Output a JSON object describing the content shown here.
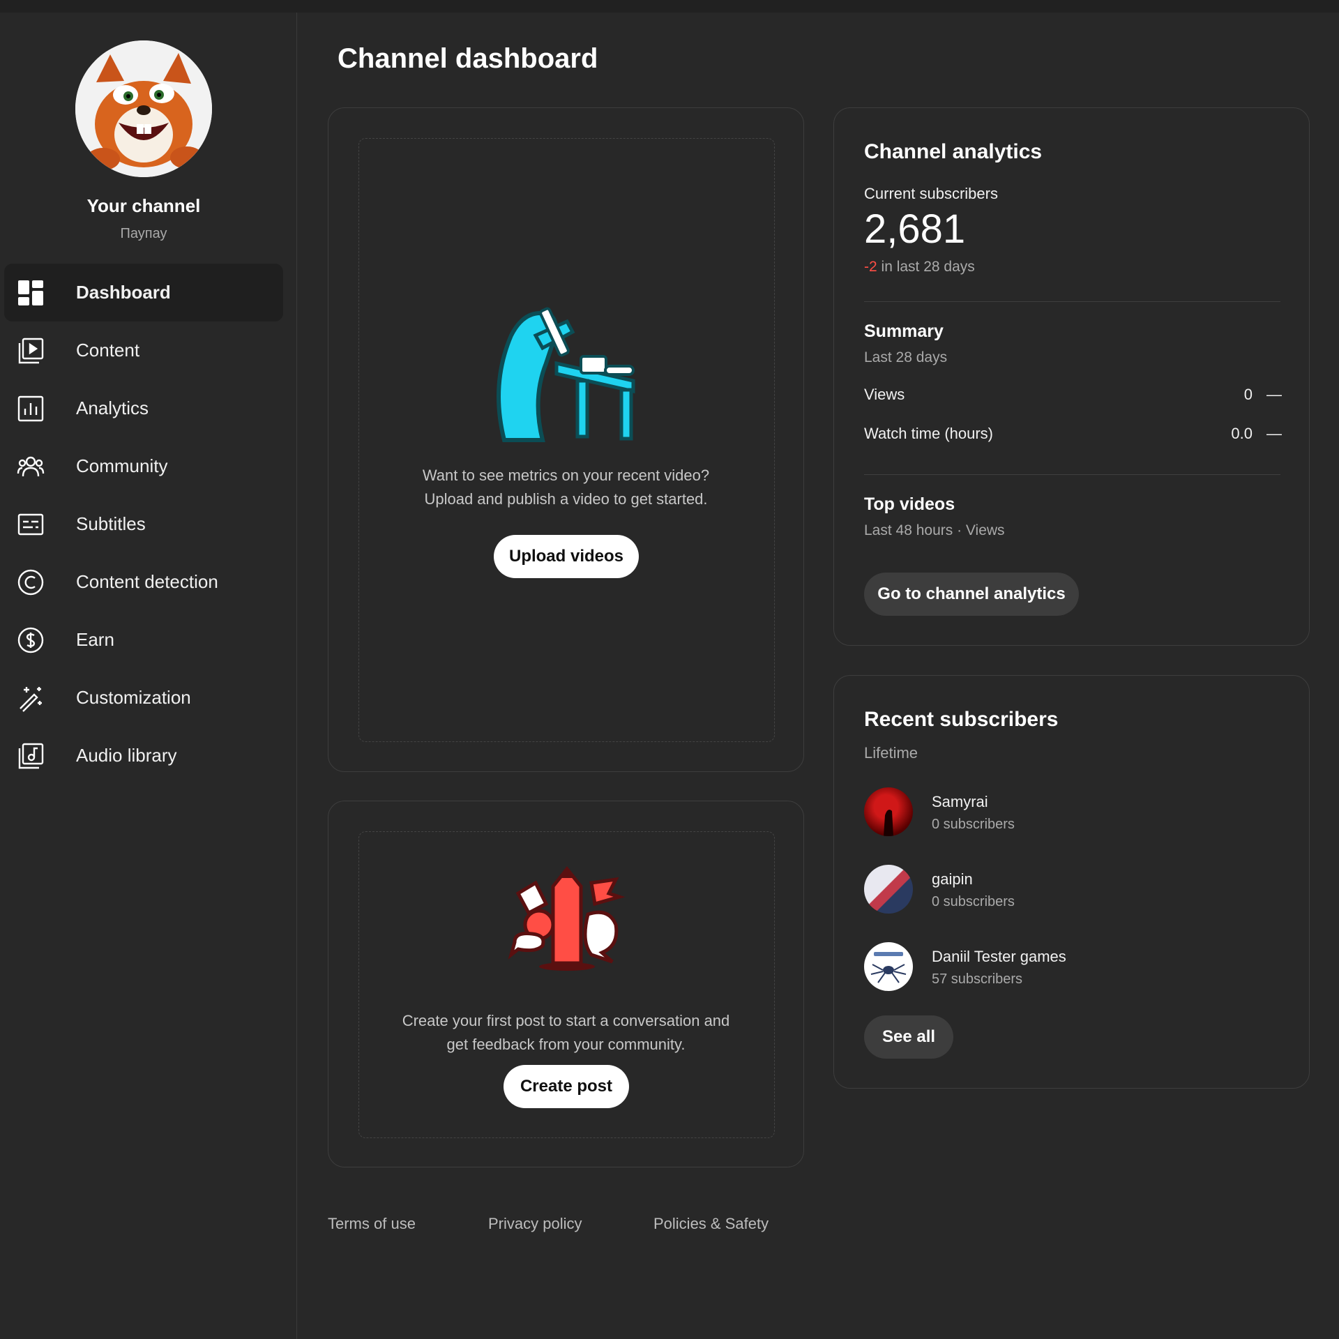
{
  "sidebar": {
    "channel_title": "Your channel",
    "channel_handle": "Паупау",
    "items": [
      {
        "label": "Dashboard",
        "icon": "dashboard-icon",
        "active": true
      },
      {
        "label": "Content",
        "icon": "content-icon"
      },
      {
        "label": "Analytics",
        "icon": "analytics-icon"
      },
      {
        "label": "Community",
        "icon": "community-icon"
      },
      {
        "label": "Subtitles",
        "icon": "subtitles-icon"
      },
      {
        "label": "Content detection",
        "icon": "copyright-icon"
      },
      {
        "label": "Earn",
        "icon": "dollar-icon"
      },
      {
        "label": "Customization",
        "icon": "magic-wand-icon"
      },
      {
        "label": "Audio library",
        "icon": "audio-library-icon"
      }
    ]
  },
  "main": {
    "page_title": "Channel dashboard",
    "upload_card": {
      "line1": "Want to see metrics on your recent video?",
      "line2": "Upload and publish a video to get started.",
      "button": "Upload videos"
    },
    "post_card": {
      "line1": "Create your first post to start a conversation and",
      "line2": "get feedback from your community.",
      "button": "Create post"
    },
    "analytics": {
      "title": "Channel analytics",
      "subs_label": "Current subscribers",
      "subs_value": "2,681",
      "change_value": "-2",
      "change_suffix": " in last 28 days",
      "summary_title": "Summary",
      "summary_period": "Last 28 days",
      "views_label": "Views",
      "views_value": "0",
      "views_trend": "—",
      "watch_label": "Watch time (hours)",
      "watch_value": "0.0",
      "watch_trend": "—",
      "top_title": "Top videos",
      "top_period": "Last 48 hours · Views",
      "button": "Go to channel analytics"
    },
    "recent": {
      "title": "Recent subscribers",
      "period": "Lifetime",
      "subs": [
        {
          "name": "Samyrai",
          "count": "0 subscribers"
        },
        {
          "name": "gaipin",
          "count": "0 subscribers"
        },
        {
          "name": "Daniil Tester games",
          "count": "57 subscribers"
        }
      ],
      "button": "See all"
    }
  },
  "footer": {
    "terms": "Terms of use",
    "privacy": "Privacy policy",
    "policies": "Policies & Safety"
  },
  "colors": {
    "background": "#282828",
    "negative": "#ff4e45",
    "upload_illustration": "#1fd3f0",
    "post_illustration": "#ff4e45"
  }
}
